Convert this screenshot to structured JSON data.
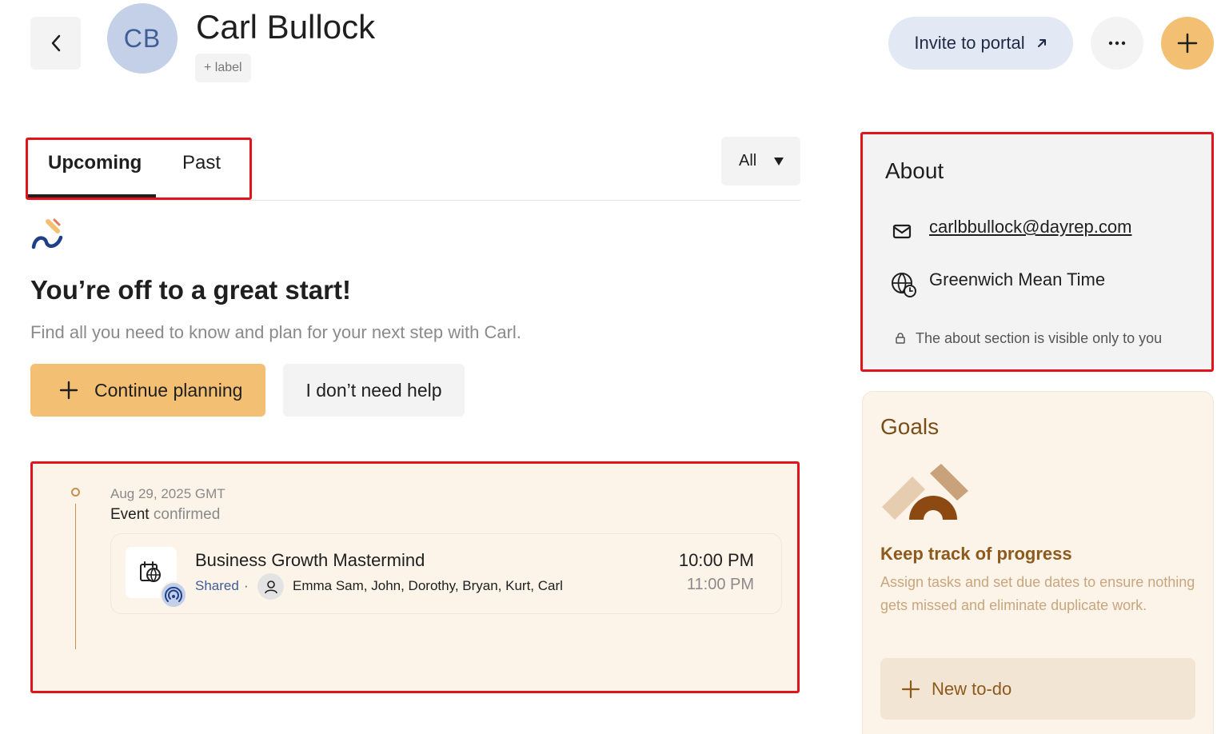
{
  "header": {
    "avatar_initials": "CB",
    "contact_name": "Carl Bullock",
    "label_chip": "+ label",
    "invite_label": "Invite to portal",
    "colors": {
      "accent": "#f2bf73",
      "avatar_bg": "#c3d0e8",
      "highlight_border": "#e0141a"
    }
  },
  "tabs": {
    "items": [
      {
        "label": "Upcoming",
        "selected": true
      },
      {
        "label": "Past",
        "selected": false
      }
    ],
    "filter_value": "All"
  },
  "onboarding": {
    "headline": "You’re off to a great start!",
    "subtext": "Find all you need to know and plan for your next step with Carl.",
    "continue_label": "Continue planning",
    "decline_label": "I don’t need help"
  },
  "timeline": {
    "date": "Aug 29, 2025 GMT",
    "status_prefix": "Event",
    "status_word": "confirmed",
    "event": {
      "title": "Business Growth Mastermind",
      "visibility": "Shared",
      "separator": "·",
      "attendees": "Emma Sam, John, Dorothy, Bryan, Kurt, Carl",
      "start_time": "10:00 PM",
      "end_time": "11:00 PM",
      "icon": "calendar-globe-icon",
      "badge_icon": "broadcast-icon"
    }
  },
  "about": {
    "title": "About",
    "email": "carlbbullock@dayrep.com",
    "timezone": "Greenwich Mean Time",
    "note": "The about section is visible only to you"
  },
  "goals": {
    "title": "Goals",
    "heading": "Keep track of progress",
    "description": "Assign tasks and set due dates to ensure nothing gets missed and eliminate duplicate work.",
    "new_todo_label": "New to-do"
  }
}
